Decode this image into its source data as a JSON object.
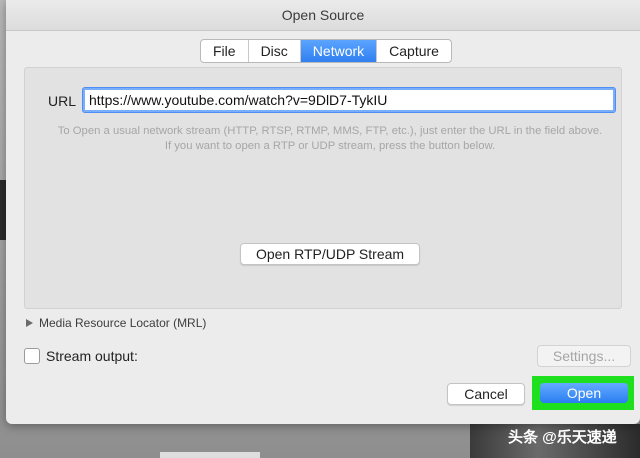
{
  "window": {
    "title": "Open Source"
  },
  "tabs": [
    {
      "label": "File",
      "active": false
    },
    {
      "label": "Disc",
      "active": false
    },
    {
      "label": "Network",
      "active": true
    },
    {
      "label": "Capture",
      "active": false
    }
  ],
  "network": {
    "url_label": "URL",
    "url_value": "https://www.youtube.com/watch?v=9DlD7-TykIU",
    "help_text": "To Open a usual network stream (HTTP, RTSP, RTMP, MMS, FTP, etc.), just enter the URL in the field above. If you want to open a RTP or UDP stream, press the button below.",
    "rtp_button_label": "Open RTP/UDP Stream"
  },
  "mrl": {
    "label": "Media Resource Locator (MRL)"
  },
  "stream_output": {
    "label": "Stream output:",
    "checked": false,
    "settings_label": "Settings..."
  },
  "actions": {
    "cancel_label": "Cancel",
    "open_label": "Open"
  },
  "watermark": {
    "text": "头条 @乐天速递"
  },
  "colors": {
    "accent": "#2f7ff0",
    "highlight": "#1fe01f"
  }
}
